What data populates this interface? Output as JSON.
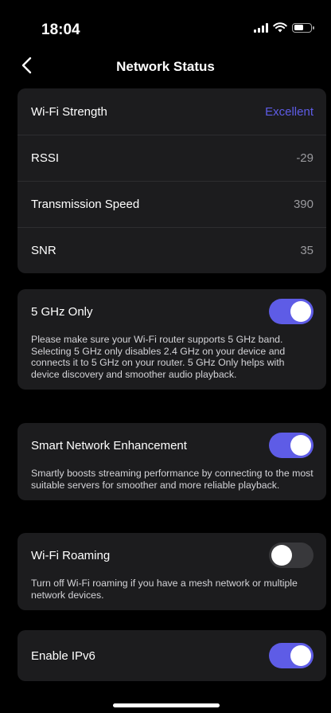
{
  "status_bar": {
    "time": "18:04"
  },
  "nav": {
    "title": "Network Status"
  },
  "wifi_info": {
    "rows": [
      {
        "label": "Wi-Fi Strength",
        "value": "Excellent"
      },
      {
        "label": "RSSI",
        "value": "-29"
      },
      {
        "label": "Transmission Speed",
        "value": "390"
      },
      {
        "label": "SNR",
        "value": "35"
      }
    ]
  },
  "settings": {
    "ghz5_only": {
      "label": "5 GHz Only",
      "on": true,
      "description": "Please make sure your Wi-Fi router supports 5 GHz band. Selecting 5 GHz only disables 2.4 GHz on your device and connects it to 5 GHz on your router. 5 GHz Only helps with device discovery and smoother audio playback."
    },
    "smart_network": {
      "label": "Smart Network Enhancement",
      "on": true,
      "description": "Smartly boosts streaming performance by connecting to the most suitable servers for smoother and more reliable playback."
    },
    "wifi_roaming": {
      "label": "Wi-Fi Roaming",
      "on": false,
      "description": "Turn off Wi-Fi roaming if you have a mesh network or multiple network devices."
    },
    "ipv6": {
      "label": "Enable IPv6",
      "on": true
    }
  },
  "colors": {
    "accent": "#5e5ce6",
    "card": "#1c1c1e",
    "toggle_off": "#38383b"
  }
}
